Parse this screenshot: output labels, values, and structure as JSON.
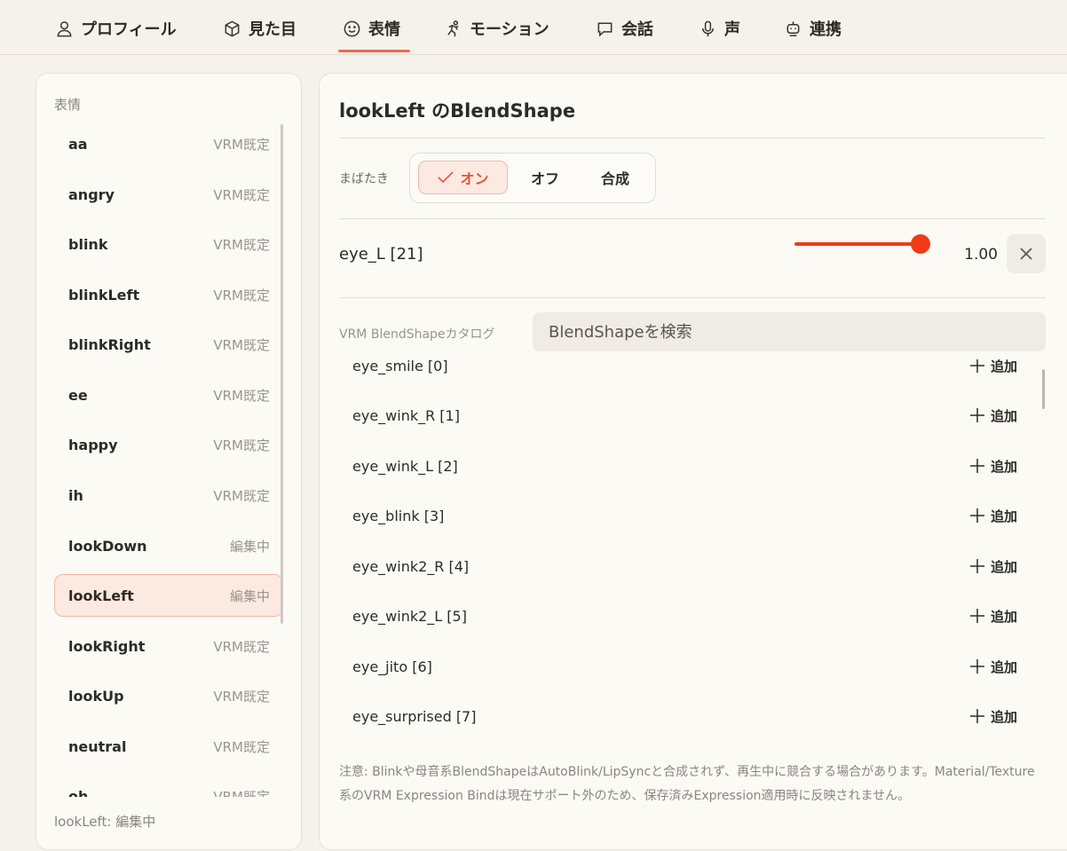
{
  "tabs": [
    {
      "id": "profile",
      "label": "プロフィール",
      "icon": "user-icon"
    },
    {
      "id": "appearance",
      "label": "見た目",
      "icon": "cube-icon"
    },
    {
      "id": "expression",
      "label": "表情",
      "icon": "smiley-icon",
      "active": true
    },
    {
      "id": "motion",
      "label": "モーション",
      "icon": "running-figure-icon"
    },
    {
      "id": "conversation",
      "label": "会話",
      "icon": "chat-bubble-icon"
    },
    {
      "id": "voice",
      "label": "声",
      "icon": "microphone-icon"
    },
    {
      "id": "integration",
      "label": "連携",
      "icon": "robot-icon"
    }
  ],
  "sidebar": {
    "heading": "表情",
    "items": [
      {
        "name": "aa",
        "status": "VRM既定"
      },
      {
        "name": "angry",
        "status": "VRM既定"
      },
      {
        "name": "blink",
        "status": "VRM既定"
      },
      {
        "name": "blinkLeft",
        "status": "VRM既定"
      },
      {
        "name": "blinkRight",
        "status": "VRM既定"
      },
      {
        "name": "ee",
        "status": "VRM既定"
      },
      {
        "name": "happy",
        "status": "VRM既定"
      },
      {
        "name": "ih",
        "status": "VRM既定"
      },
      {
        "name": "lookDown",
        "status": "編集中"
      },
      {
        "name": "lookLeft",
        "status": "編集中",
        "selected": true
      },
      {
        "name": "lookRight",
        "status": "VRM既定"
      },
      {
        "name": "lookUp",
        "status": "VRM既定"
      },
      {
        "name": "neutral",
        "status": "VRM既定"
      },
      {
        "name": "oh",
        "status": "VRM既定"
      }
    ],
    "footer": "lookLeft: 編集中"
  },
  "editor": {
    "title": "lookLeft のBlendShape",
    "blink": {
      "label": "まばたき",
      "options": {
        "on": "オン",
        "off": "オフ",
        "mix": "合成"
      },
      "selected": "on"
    },
    "binding": {
      "name": "eye_L [21]",
      "weight": 1.0,
      "weight_label": "1.00"
    },
    "catalog": {
      "label": "VRM BlendShapeカタログ",
      "search_placeholder": "BlendShapeを検索",
      "add_label": "追加",
      "items": [
        "eye_smile [0]",
        "eye_wink_R [1]",
        "eye_wink_L [2]",
        "eye_blink [3]",
        "eye_wink2_R [4]",
        "eye_wink2_L [5]",
        "eye_jito [6]",
        "eye_surprised [7]"
      ]
    },
    "note": "注意: Blinkや母音系BlendShapeはAutoBlink/LipSyncと合成されず、再生中に競合する場合があります。Material/Texture系のVRM Expression Bindは現在サポート外のため、保存済みExpression適用時に反映されません。"
  },
  "colors": {
    "accent": "#ef3b18",
    "selected_bg": "#fce9e2",
    "selected_border": "#f0b7a7"
  }
}
